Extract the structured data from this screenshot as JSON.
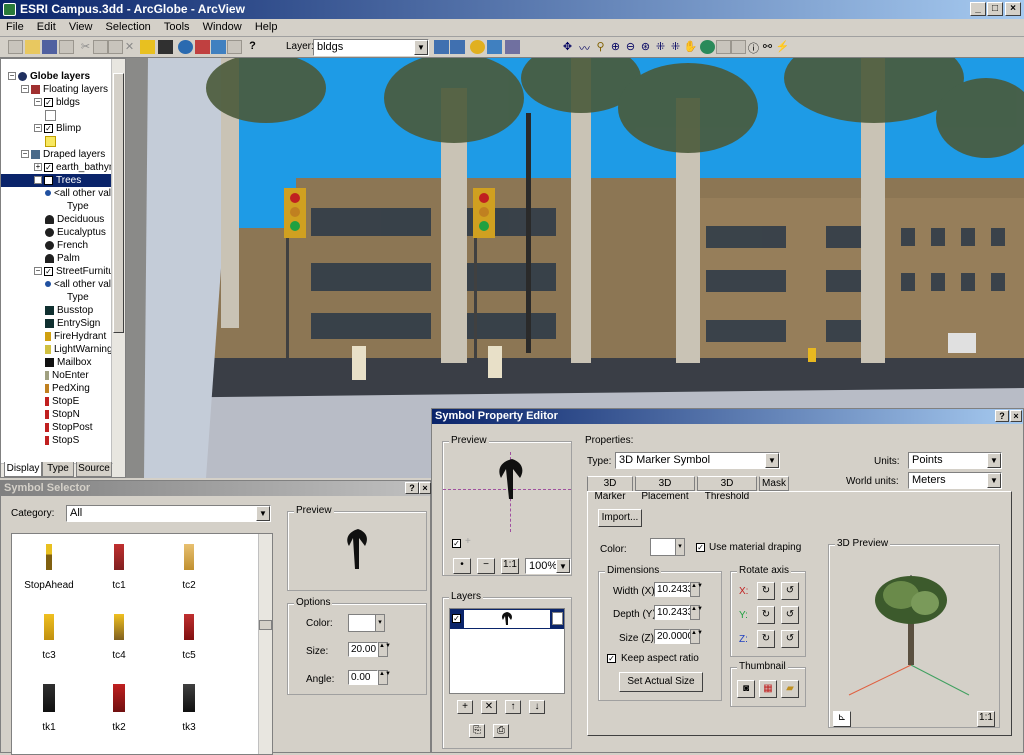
{
  "window": {
    "title": "ESRI Campus.3dd - ArcGlobe - ArcView"
  },
  "menu": [
    "File",
    "Edit",
    "View",
    "Selection",
    "Tools",
    "Window",
    "Help"
  ],
  "toolbar": {
    "layer_label": "Layer:",
    "layer_value": "bldgs"
  },
  "toc": {
    "root": "Globe layers",
    "floating": "Floating layers",
    "bldgs": "bldgs",
    "blimp": "Blimp",
    "draped": "Draped layers",
    "earth": "earth_bathymetry",
    "trees": "Trees",
    "all_other": "<all other values>",
    "type": "Type",
    "tree_classes": [
      "Deciduous",
      "Eucalyptus",
      "French",
      "Palm"
    ],
    "street": "StreetFurniture",
    "all_other2": "<all other values>",
    "type2": "Type",
    "street_classes": [
      "Busstop",
      "EntrySign",
      "FireHydrant",
      "LightWarning",
      "Mailbox",
      "NoEnter",
      "PedXing",
      "StopE",
      "StopN",
      "StopPost",
      "StopS"
    ],
    "tabs": [
      "Display",
      "Type",
      "Source"
    ]
  },
  "symbol_selector": {
    "title": "Symbol Selector",
    "category_label": "Category:",
    "category_value": "All",
    "symbols": [
      "StopAhead",
      "tc1",
      "tc2",
      "tc3",
      "tc4",
      "tc5",
      "tk1",
      "tk2",
      "tk3"
    ],
    "preview_label": "Preview",
    "options_label": "Options",
    "color_label": "Color:",
    "size_label": "Size:",
    "size_value": "20.00",
    "angle_label": "Angle:",
    "angle_value": "0.00"
  },
  "spe": {
    "title": "Symbol Property Editor",
    "preview_label": "Preview",
    "zoom_value": "100%",
    "layers_label": "Layers",
    "properties_label": "Properties:",
    "type_label": "Type:",
    "type_value": "3D Marker Symbol",
    "units_label": "Units:",
    "units_value": "Points",
    "world_units_label": "World units:",
    "world_units_value": "Meters",
    "tabs": [
      "3D Marker",
      "3D Placement",
      "3D Threshold",
      "Mask"
    ],
    "import_label": "Import...",
    "color_label": "Color:",
    "use_material": "Use material draping",
    "dimensions_label": "Dimensions",
    "width_label": "Width (X):",
    "width_value": "10.2433",
    "depth_label": "Depth (Y):",
    "depth_value": "10.2433",
    "size_label": "Size (Z):",
    "size_value": "20.0000",
    "keep_aspect": "Keep aspect ratio",
    "set_actual": "Set Actual Size",
    "rotate_label": "Rotate axis",
    "axes": [
      "X:",
      "Y:",
      "Z:"
    ],
    "thumbnail_label": "Thumbnail",
    "preview3d_label": "3D Preview"
  },
  "colors": {
    "accent": "#0a246a",
    "sky": "#1e9be6",
    "building": "#8c7654"
  }
}
